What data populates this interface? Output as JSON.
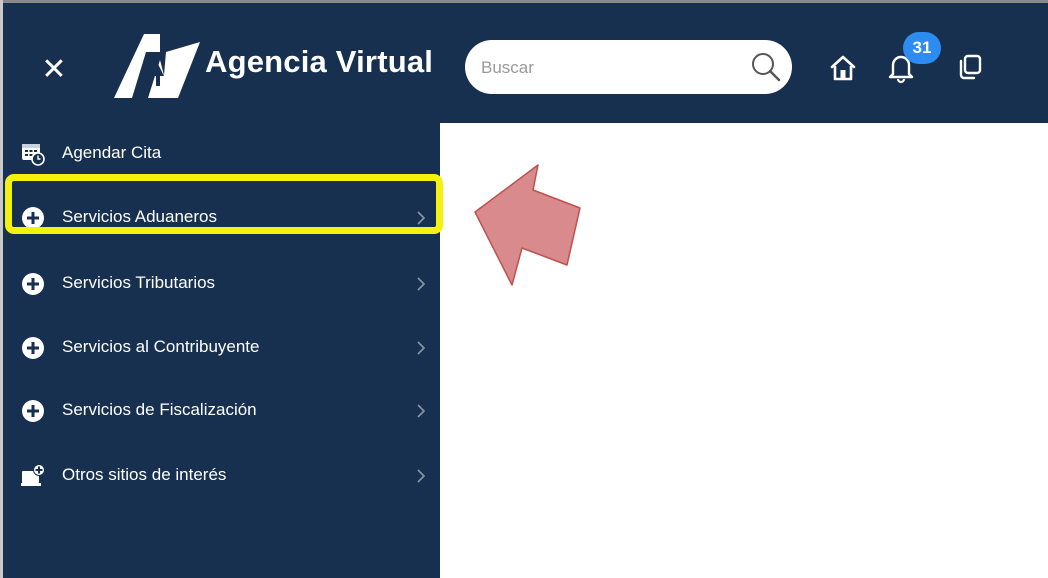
{
  "header": {
    "app_title": "Agencia Virtual",
    "logo_icon": "av-logo-icon",
    "search": {
      "placeholder": "Buscar",
      "value": ""
    },
    "notifications_count": "31",
    "colors": {
      "background": "#17304f",
      "badge": "#2d8cf0"
    }
  },
  "sidebar": {
    "items": [
      {
        "label": "Agendar Cita",
        "icon": "calendar-clock-icon",
        "has_chevron": false
      },
      {
        "label": "Servicios Aduaneros",
        "icon": "plus-circle-icon",
        "has_chevron": true,
        "highlighted": true
      },
      {
        "label": "Servicios Tributarios",
        "icon": "plus-circle-icon",
        "has_chevron": true
      },
      {
        "label": "Servicios al Contribuyente",
        "icon": "plus-circle-icon",
        "has_chevron": true
      },
      {
        "label": "Servicios de Fiscalización",
        "icon": "plus-circle-icon",
        "has_chevron": true
      },
      {
        "label": "Otros sitios de interés",
        "icon": "monitor-plus-icon",
        "has_chevron": true
      }
    ]
  },
  "annotation": {
    "highlight_color": "#f5f10e",
    "arrow_color": "#d9888a"
  }
}
